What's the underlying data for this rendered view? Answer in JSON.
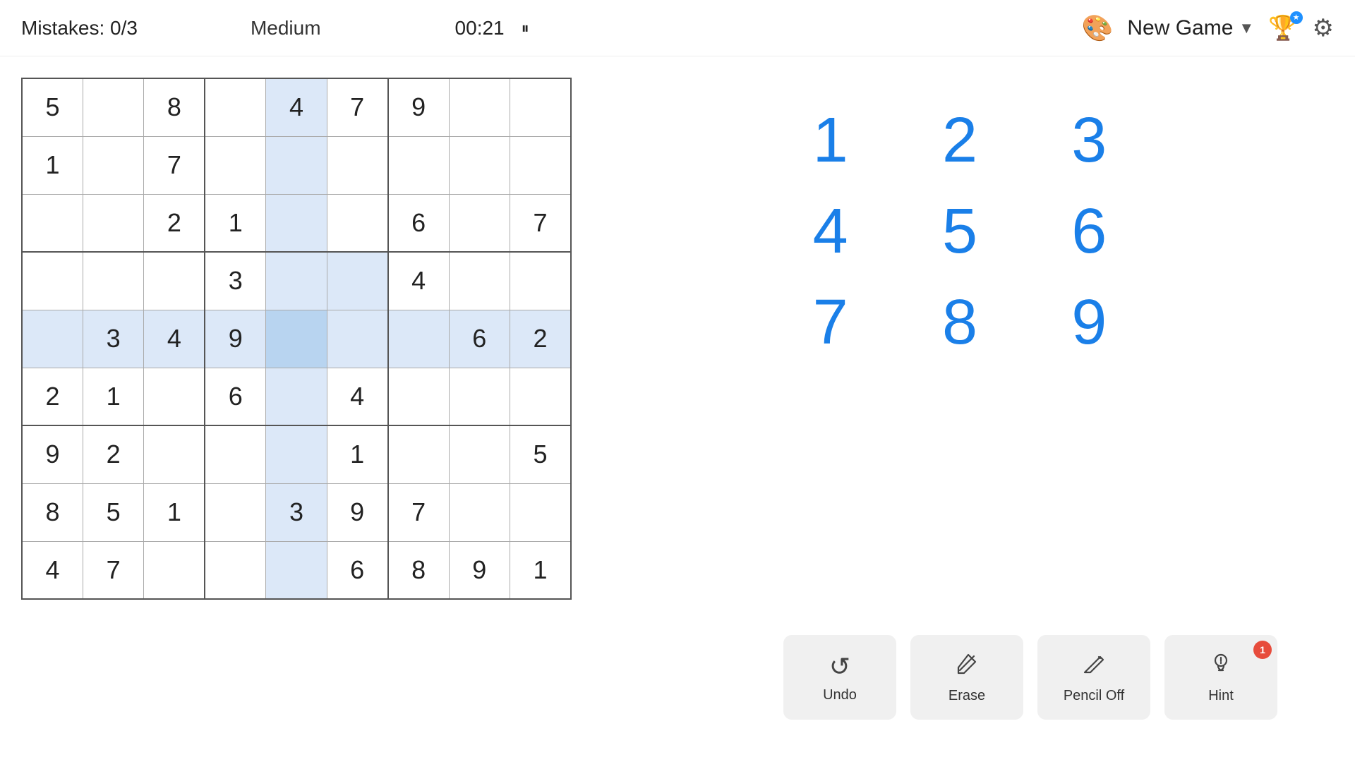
{
  "header": {
    "mistakes_label": "Mistakes: 0/3",
    "difficulty": "Medium",
    "timer": "00:21",
    "pause_icon": "⏸",
    "palette_icon": "🎨",
    "new_game_label": "New Game",
    "chevron_icon": "▼",
    "trophy_icon": "🏆",
    "settings_icon": "⚙",
    "badge_count": "★"
  },
  "grid": {
    "rows": [
      [
        {
          "val": "5",
          "type": "given",
          "highlight": "none"
        },
        {
          "val": "",
          "type": "empty",
          "highlight": "none"
        },
        {
          "val": "8",
          "type": "given",
          "highlight": "none"
        },
        {
          "val": "",
          "type": "empty",
          "highlight": "none"
        },
        {
          "val": "4",
          "type": "given",
          "highlight": "selected-col"
        },
        {
          "val": "7",
          "type": "given",
          "highlight": "none"
        },
        {
          "val": "9",
          "type": "given",
          "highlight": "none"
        },
        {
          "val": "",
          "type": "empty",
          "highlight": "none"
        },
        {
          "val": "",
          "type": "empty",
          "highlight": "none"
        }
      ],
      [
        {
          "val": "1",
          "type": "given",
          "highlight": "none"
        },
        {
          "val": "",
          "type": "empty",
          "highlight": "none"
        },
        {
          "val": "7",
          "type": "given",
          "highlight": "none"
        },
        {
          "val": "",
          "type": "empty",
          "highlight": "none"
        },
        {
          "val": "",
          "type": "empty",
          "highlight": "selected-col"
        },
        {
          "val": "",
          "type": "empty",
          "highlight": "none"
        },
        {
          "val": "",
          "type": "empty",
          "highlight": "none"
        },
        {
          "val": "",
          "type": "empty",
          "highlight": "none"
        },
        {
          "val": "",
          "type": "empty",
          "highlight": "none"
        }
      ],
      [
        {
          "val": "",
          "type": "empty",
          "highlight": "none"
        },
        {
          "val": "",
          "type": "empty",
          "highlight": "none"
        },
        {
          "val": "2",
          "type": "given",
          "highlight": "none"
        },
        {
          "val": "1",
          "type": "given",
          "highlight": "none"
        },
        {
          "val": "",
          "type": "empty",
          "highlight": "selected-col"
        },
        {
          "val": "",
          "type": "empty",
          "highlight": "none"
        },
        {
          "val": "6",
          "type": "given",
          "highlight": "none"
        },
        {
          "val": "",
          "type": "empty",
          "highlight": "none"
        },
        {
          "val": "7",
          "type": "given",
          "highlight": "none"
        }
      ],
      [
        {
          "val": "",
          "type": "empty",
          "highlight": "none"
        },
        {
          "val": "",
          "type": "empty",
          "highlight": "none"
        },
        {
          "val": "",
          "type": "empty",
          "highlight": "none"
        },
        {
          "val": "3",
          "type": "given",
          "highlight": "none"
        },
        {
          "val": "",
          "type": "empty",
          "highlight": "selected-col"
        },
        {
          "val": "",
          "type": "empty",
          "highlight": "selected-row"
        },
        {
          "val": "4",
          "type": "given",
          "highlight": "none"
        },
        {
          "val": "",
          "type": "empty",
          "highlight": "none"
        },
        {
          "val": "",
          "type": "empty",
          "highlight": "none"
        }
      ],
      [
        {
          "val": "",
          "type": "empty",
          "highlight": "selected-row"
        },
        {
          "val": "3",
          "type": "given",
          "highlight": "selected-row"
        },
        {
          "val": "4",
          "type": "given",
          "highlight": "selected-row"
        },
        {
          "val": "9",
          "type": "given",
          "highlight": "selected-row"
        },
        {
          "val": "",
          "type": "empty",
          "highlight": "selected-cell"
        },
        {
          "val": "",
          "type": "empty",
          "highlight": "selected-row"
        },
        {
          "val": "",
          "type": "empty",
          "highlight": "selected-row"
        },
        {
          "val": "6",
          "type": "given",
          "highlight": "selected-row"
        },
        {
          "val": "2",
          "type": "given",
          "highlight": "selected-row"
        }
      ],
      [
        {
          "val": "2",
          "type": "given",
          "highlight": "none"
        },
        {
          "val": "1",
          "type": "given",
          "highlight": "none"
        },
        {
          "val": "",
          "type": "empty",
          "highlight": "none"
        },
        {
          "val": "6",
          "type": "given",
          "highlight": "none"
        },
        {
          "val": "",
          "type": "empty",
          "highlight": "selected-col"
        },
        {
          "val": "4",
          "type": "given",
          "highlight": "none"
        },
        {
          "val": "",
          "type": "empty",
          "highlight": "none"
        },
        {
          "val": "",
          "type": "empty",
          "highlight": "none"
        },
        {
          "val": "",
          "type": "empty",
          "highlight": "none"
        }
      ],
      [
        {
          "val": "9",
          "type": "given",
          "highlight": "none"
        },
        {
          "val": "2",
          "type": "given",
          "highlight": "none"
        },
        {
          "val": "",
          "type": "empty",
          "highlight": "none"
        },
        {
          "val": "",
          "type": "empty",
          "highlight": "none"
        },
        {
          "val": "",
          "type": "empty",
          "highlight": "selected-col"
        },
        {
          "val": "1",
          "type": "given",
          "highlight": "none"
        },
        {
          "val": "",
          "type": "empty",
          "highlight": "none"
        },
        {
          "val": "",
          "type": "empty",
          "highlight": "none"
        },
        {
          "val": "5",
          "type": "given",
          "highlight": "none"
        }
      ],
      [
        {
          "val": "8",
          "type": "given",
          "highlight": "none"
        },
        {
          "val": "5",
          "type": "given",
          "highlight": "none"
        },
        {
          "val": "1",
          "type": "given",
          "highlight": "none"
        },
        {
          "val": "",
          "type": "empty",
          "highlight": "none"
        },
        {
          "val": "3",
          "type": "given",
          "highlight": "selected-col"
        },
        {
          "val": "9",
          "type": "given",
          "highlight": "none"
        },
        {
          "val": "7",
          "type": "given",
          "highlight": "none"
        },
        {
          "val": "",
          "type": "empty",
          "highlight": "none"
        },
        {
          "val": "",
          "type": "empty",
          "highlight": "none"
        }
      ],
      [
        {
          "val": "4",
          "type": "given",
          "highlight": "none"
        },
        {
          "val": "7",
          "type": "given",
          "highlight": "none"
        },
        {
          "val": "",
          "type": "empty",
          "highlight": "none"
        },
        {
          "val": "",
          "type": "empty",
          "highlight": "none"
        },
        {
          "val": "",
          "type": "empty",
          "highlight": "selected-col"
        },
        {
          "val": "6",
          "type": "given",
          "highlight": "none"
        },
        {
          "val": "8",
          "type": "given",
          "highlight": "none"
        },
        {
          "val": "9",
          "type": "given",
          "highlight": "none"
        },
        {
          "val": "1",
          "type": "given",
          "highlight": "none"
        }
      ]
    ]
  },
  "number_pad": {
    "numbers": [
      "1",
      "2",
      "3",
      "4",
      "5",
      "6",
      "7",
      "8",
      "9"
    ]
  },
  "controls": {
    "undo_label": "Undo",
    "erase_label": "Erase",
    "pencil_label": "Pencil Off",
    "hint_label": "Hint",
    "hint_badge": "1"
  }
}
